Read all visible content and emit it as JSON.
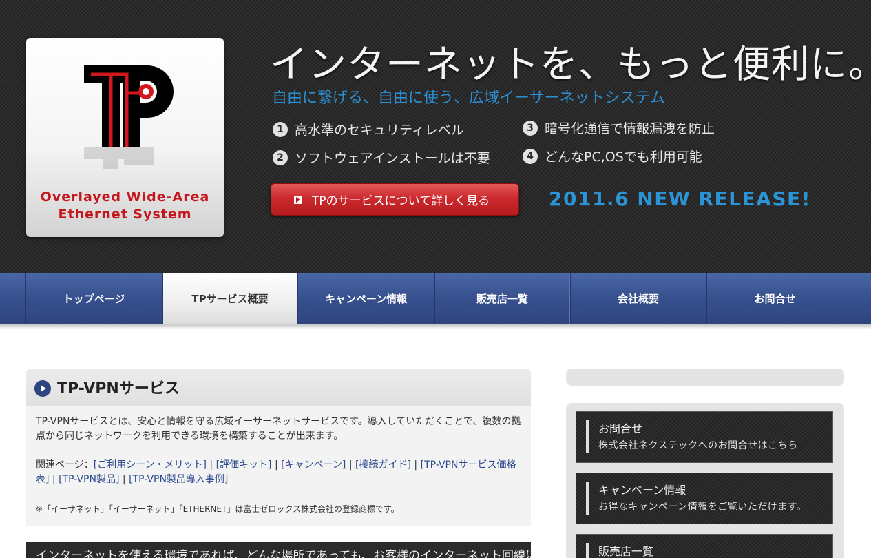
{
  "header": {
    "logo": {
      "line1": "Overlayed Wide-Area",
      "line2": "Ethernet System"
    },
    "headline": "インターネットを、もっと便利に。",
    "subhead": "自由に繋げる、自由に使う、広域イーサーネットシステム",
    "features": [
      {
        "num": "1",
        "text": "高水準のセキュリティレベル"
      },
      {
        "num": "2",
        "text": "ソフトウェアインストールは不要"
      },
      {
        "num": "3",
        "text": "暗号化通信で情報漏洩を防止"
      },
      {
        "num": "4",
        "text": "どんなPC,OSでも利用可能"
      }
    ],
    "cta_label": "TPのサービスについて詳しく見る",
    "release": "2011.6 NEW RELEASE!",
    "colors": {
      "accent_blue": "#2b8fd1",
      "logo_red": "#c4161c"
    }
  },
  "nav": {
    "items": [
      {
        "label": "トップページ"
      },
      {
        "label": "TPサービス概要"
      },
      {
        "label": "キャンペーン情報"
      },
      {
        "label": "販売店一覧"
      },
      {
        "label": "会社概要"
      },
      {
        "label": "お問合せ"
      }
    ],
    "active_index": 1
  },
  "main": {
    "title": "TP-VPNサービス",
    "paragraph1": "TP-VPNサービスとは、安心と情報を守る広域イーサーネットサービスです。導入していただくことで、複数の拠点から同じネットワークを利用できる環境を構築することが出来ます。",
    "related_prefix": "関連ページ：",
    "related_links": [
      "[ご利用シーン・メリット]",
      "[評価キット]",
      "[キャンペーン]",
      "[接続ガイド]",
      "[TP-VPNサービス価格表]",
      "[TP-VPN製品]",
      "[TP-VPN製品導入事例]"
    ],
    "separator": " | ",
    "trademark_note": "※「イーサネット」「イーサーネット」「ETHERNET」は富士ゼロックス株式会社の登録商標です。",
    "dark_band_text": "インターネットを使える環境であれば、どんな場所であっても、お客様のインターネット回線に"
  },
  "sidebar": {
    "boxes": [
      {
        "title": "お問合せ",
        "sub": "株式会社ネクステックへのお問合せはこちら"
      },
      {
        "title": "キャンペーン情報",
        "sub": "お得なキャンペーン情報をご覧いただけます。"
      },
      {
        "title": "販売店一覧",
        "sub": ""
      }
    ]
  }
}
